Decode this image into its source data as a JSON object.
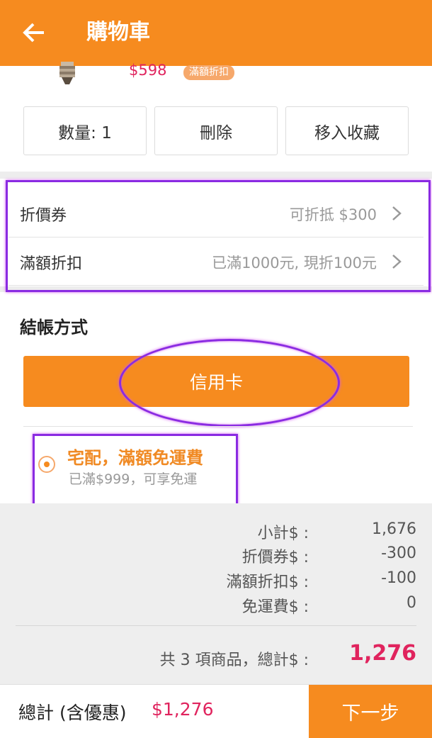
{
  "header": {
    "title": "購物車",
    "back_icon": "arrow-left-icon"
  },
  "product": {
    "price": "$598",
    "promo_tag": "滿額折扣",
    "thumb_icon": "light-bulb-icon"
  },
  "actions": {
    "quantity_label": "數量: 1",
    "delete_label": "刪除",
    "favorite_label": "移入收藏"
  },
  "discounts": [
    {
      "label": "折價券",
      "value": "可折抵 $300"
    },
    {
      "label": "滿額折扣",
      "value": "已滿1000元, 現折100元"
    }
  ],
  "checkout": {
    "section_title": "結帳方式",
    "payment_method": "信用卡"
  },
  "shipping": {
    "title": "宅配，滿額免運費",
    "subtitle": "已滿$999，可享免運"
  },
  "summary": {
    "rows": [
      {
        "label": "小計$ :",
        "value": "1,676"
      },
      {
        "label": "折價券$ :",
        "value": "-300"
      },
      {
        "label": "滿額折扣$ :",
        "value": "-100"
      },
      {
        "label": "免運費$ :",
        "value": "0"
      }
    ],
    "total_label": "共 3 項商品，總計$ :",
    "total_value": "1,276"
  },
  "footer": {
    "grand_total_label": "總計 (含優惠)",
    "grand_total_value": "$1,276",
    "next_label": "下一步"
  },
  "colors": {
    "brand_orange": "#f68b1f",
    "price_red": "#e0245e",
    "highlight_purple": "#8a2be2"
  }
}
